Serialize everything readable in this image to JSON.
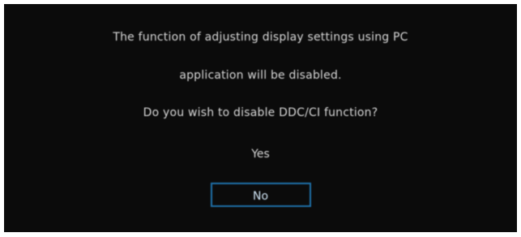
{
  "dialog": {
    "message_line1": "The function of adjusting display settings using PC",
    "message_line2": "application will be disabled.",
    "message_line3": "Do you wish to disable DDC/CI function?",
    "yes_label": "Yes",
    "no_label": "No"
  },
  "colors": {
    "background": "#0b0b0b",
    "text": "#d8d8d8",
    "focus_border": "#1f6fa8"
  }
}
